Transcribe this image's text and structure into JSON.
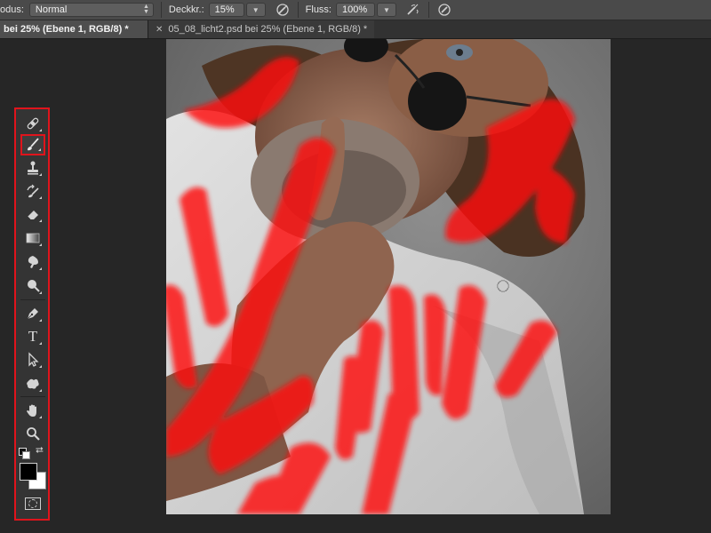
{
  "options_bar": {
    "mode_label": "odus:",
    "mode_value": "Normal",
    "opacity_label": "Deckkr.:",
    "opacity_value": "15%",
    "flow_label": "Fluss:",
    "flow_value": "100%"
  },
  "tabs": [
    {
      "label": "bei 25% (Ebene 1, RGB/8) *",
      "active": true
    },
    {
      "label": "05_08_licht2.psd bei 25% (Ebene 1, RGB/8) *",
      "active": false
    }
  ],
  "toolbar": {
    "tools": [
      {
        "name": "spot-healing-brush-icon",
        "selected": false
      },
      {
        "name": "brush-icon",
        "selected": true
      },
      {
        "name": "clone-stamp-icon",
        "selected": false
      },
      {
        "name": "history-brush-icon",
        "selected": false
      },
      {
        "name": "eraser-icon",
        "selected": false
      },
      {
        "name": "gradient-icon",
        "selected": false
      },
      {
        "name": "blur-icon",
        "selected": false
      },
      {
        "name": "dodge-icon",
        "selected": false
      },
      {
        "name": "pen-icon",
        "selected": false
      },
      {
        "name": "type-icon",
        "selected": false
      },
      {
        "name": "path-selection-icon",
        "selected": false
      },
      {
        "name": "custom-shape-icon",
        "selected": false
      },
      {
        "name": "hand-icon",
        "selected": false
      },
      {
        "name": "zoom-icon",
        "selected": false
      }
    ],
    "type_glyph": "T",
    "foreground_color": "#000000",
    "background_color": "#ffffff"
  },
  "colors": {
    "highlight": "#e0141c",
    "paint": "#ff1010",
    "panel_bg": "#343434",
    "options_bg": "#4a4a4a"
  }
}
